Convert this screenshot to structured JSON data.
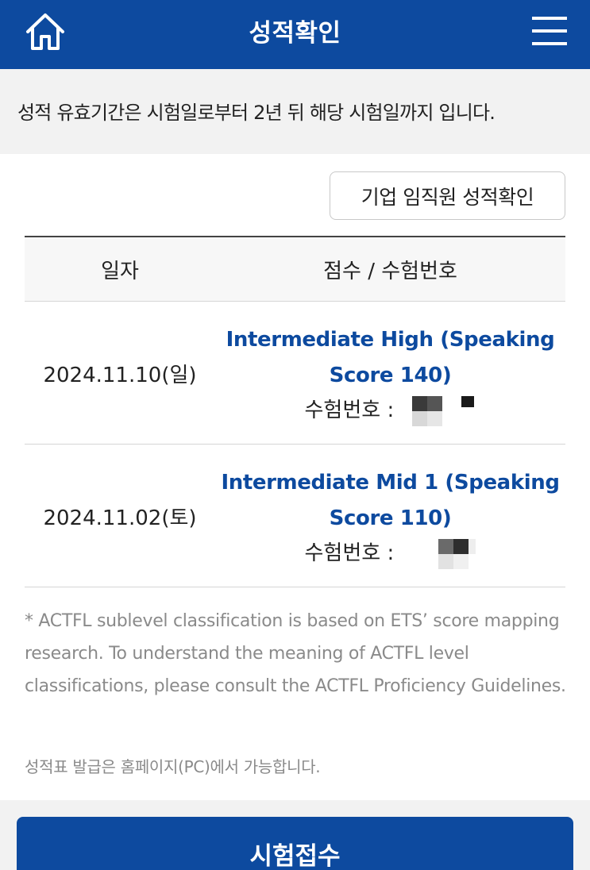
{
  "header": {
    "title": "성적확인",
    "home_icon": "home-icon",
    "menu_icon": "hamburger-menu-icon"
  },
  "notice": "성적 유효기간은 시험일로부터 2년 뒤 해당 시험일까지 입니다.",
  "corp_button": "기업 임직원 성적확인",
  "table": {
    "headers": [
      "일자",
      "점수 / 수험번호"
    ],
    "rows": [
      {
        "date": "2024.11.10(일)",
        "score_line1": "Intermediate High (Speaking",
        "score_line2": "Score 140)",
        "exam_label": "수험번호 :"
      },
      {
        "date": "2024.11.02(토)",
        "score_line1": "Intermediate Mid 1 (Speaking",
        "score_line2": "Score 110)",
        "exam_label": "수험번호 :"
      }
    ]
  },
  "disclaimer": "* ACTFL sublevel classification is based on ETS’ score mapping research. To understand the meaning of ACTFL level classifications, please consult the ACTFL Proficiency Guidelines.",
  "issue_note": "성적표 발급은 홈페이지(PC)에서 가능합니다.",
  "apply_button": "시험접수",
  "colors": {
    "brand_blue": "#0d4a9f",
    "notice_bg": "#f2f2f2",
    "muted_text": "#8a8a8a"
  }
}
